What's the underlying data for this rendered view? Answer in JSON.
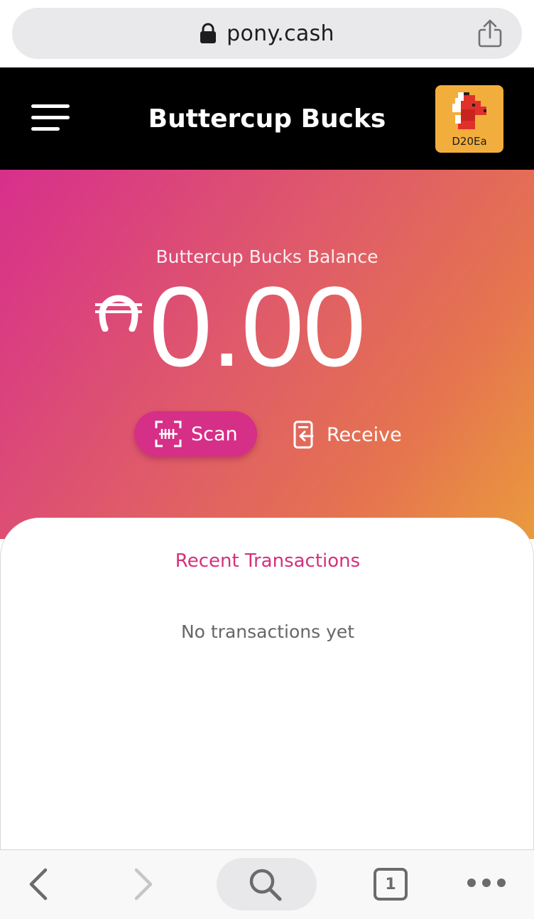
{
  "browser": {
    "url": "pony.cash",
    "icons": {
      "lock": "lock-icon",
      "share": "share-icon"
    }
  },
  "header": {
    "title": "Buttercup Bucks",
    "avatar_label": "D20Ea",
    "icons": {
      "menu": "hamburger-menu-icon",
      "avatar": "pony-avatar-icon"
    },
    "colors": {
      "background": "#000000",
      "avatar_bg": "#f2ae3c"
    }
  },
  "balance": {
    "label": "Buttercup Bucks Balance",
    "amount": "0.00",
    "currency_icon": "horseshoe-currency-icon"
  },
  "actions": {
    "scan_label": "Scan",
    "receive_label": "Receive",
    "icons": {
      "scan": "scan-icon",
      "receive": "receive-icon"
    }
  },
  "transactions": {
    "title": "Recent Transactions",
    "empty_message": "No transactions yet"
  },
  "toolbar": {
    "tab_count": "1",
    "icons": {
      "back": "back-arrow-icon",
      "forward": "forward-arrow-icon",
      "search": "search-icon",
      "tabs": "tabs-icon",
      "more": "more-icon"
    }
  },
  "colors": {
    "accent": "#d4317c",
    "scan_button": "#d62f87",
    "gradient_start": "#d72f8c",
    "gradient_end": "#ea9a3d"
  }
}
